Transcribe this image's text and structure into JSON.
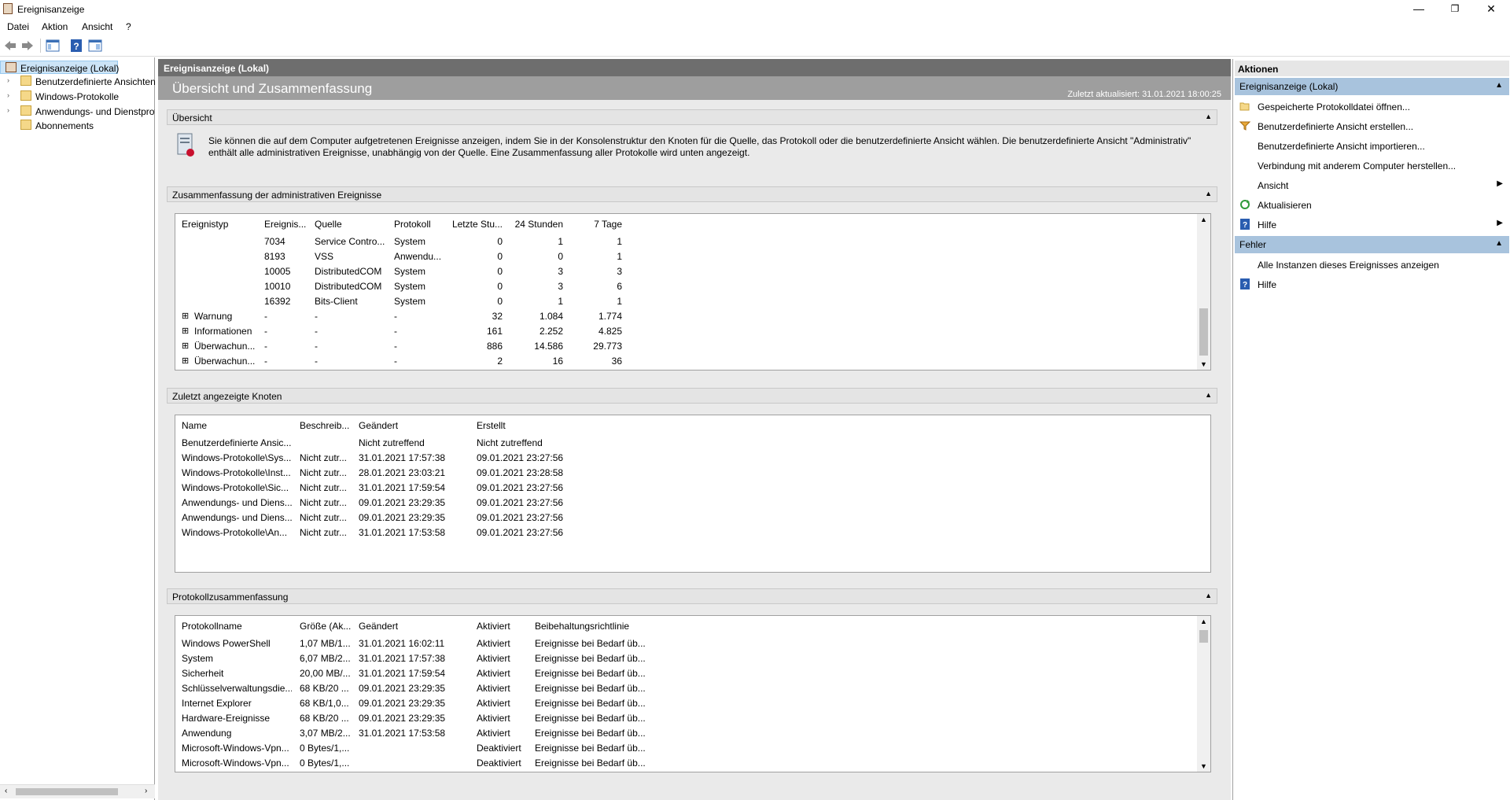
{
  "window": {
    "title": "Ereignisanzeige",
    "minimize": "—",
    "maximize": "❐",
    "close": "✕"
  },
  "menu": [
    "Datei",
    "Aktion",
    "Ansicht",
    "?"
  ],
  "tree": {
    "items": [
      {
        "label": "Ereignisanzeige (Lokal)",
        "level": 0,
        "selected": true
      },
      {
        "label": "Benutzerdefinierte Ansichten",
        "level": 1
      },
      {
        "label": "Windows-Protokolle",
        "level": 1
      },
      {
        "label": "Anwendungs- und Dienstprotokolle",
        "level": 1
      },
      {
        "label": "Abonnements",
        "level": 1
      }
    ]
  },
  "center": {
    "header": "Ereignisanzeige (Lokal)",
    "subtitle": "Übersicht und Zusammenfassung",
    "updated": "Zuletzt aktualisiert: 31.01.2021 18:00:25",
    "overview": {
      "title": "Übersicht",
      "text": "Sie können die auf dem Computer aufgetretenen Ereignisse anzeigen, indem Sie in der Konsolenstruktur den Knoten für die Quelle, das Protokoll oder die benutzerdefinierte Ansicht wählen. Die benutzerdefinierte Ansicht \"Administrativ\" enthält alle administrativen Ereignisse, unabhängig von der Quelle. Eine Zusammenfassung aller Protokolle wird unten angezeigt."
    },
    "summary": {
      "title": "Zusammenfassung der administrativen Ereignisse",
      "columns": [
        "Ereignistyp",
        "Ereignis...",
        "Quelle",
        "Protokoll",
        "Letzte Stu...",
        "24 Stunden",
        "7 Tage"
      ],
      "rows": [
        [
          "",
          "7034",
          "Service Contro...",
          "System",
          "0",
          "1",
          "1"
        ],
        [
          "",
          "8193",
          "VSS",
          "Anwendu...",
          "0",
          "0",
          "1"
        ],
        [
          "",
          "10005",
          "DistributedCOM",
          "System",
          "0",
          "3",
          "3"
        ],
        [
          "",
          "10010",
          "DistributedCOM",
          "System",
          "0",
          "3",
          "6"
        ],
        [
          "",
          "16392",
          "Bits-Client",
          "System",
          "0",
          "1",
          "1"
        ],
        [
          "Warnung",
          "-",
          "-",
          "-",
          "32",
          "1.084",
          "1.774"
        ],
        [
          "Informationen",
          "-",
          "-",
          "-",
          "161",
          "2.252",
          "4.825"
        ],
        [
          "Überwachun...",
          "-",
          "-",
          "-",
          "886",
          "14.586",
          "29.773"
        ],
        [
          "Überwachun...",
          "-",
          "-",
          "-",
          "2",
          "16",
          "36"
        ]
      ]
    },
    "recent": {
      "title": "Zuletzt angezeigte Knoten",
      "columns": [
        "Name",
        "Beschreib...",
        "Geändert",
        "Erstellt"
      ],
      "rows": [
        [
          "Benutzerdefinierte Ansic...",
          "",
          "Nicht zutreffend",
          "Nicht zutreffend"
        ],
        [
          "Windows-Protokolle\\Sys...",
          "Nicht zutr...",
          "31.01.2021 17:57:38",
          "09.01.2021 23:27:56"
        ],
        [
          "Windows-Protokolle\\Inst...",
          "Nicht zutr...",
          "28.01.2021 23:03:21",
          "09.01.2021 23:28:58"
        ],
        [
          "Windows-Protokolle\\Sic...",
          "Nicht zutr...",
          "31.01.2021 17:59:54",
          "09.01.2021 23:27:56"
        ],
        [
          "Anwendungs- und Diens...",
          "Nicht zutr...",
          "09.01.2021 23:29:35",
          "09.01.2021 23:27:56"
        ],
        [
          "Anwendungs- und Diens...",
          "Nicht zutr...",
          "09.01.2021 23:29:35",
          "09.01.2021 23:27:56"
        ],
        [
          "Windows-Protokolle\\An...",
          "Nicht zutr...",
          "31.01.2021 17:53:58",
          "09.01.2021 23:27:56"
        ]
      ]
    },
    "logs": {
      "title": "Protokollzusammenfassung",
      "columns": [
        "Protokollname",
        "Größe (Ak...",
        "Geändert",
        "Aktiviert",
        "Beibehaltungsrichtlinie"
      ],
      "rows": [
        [
          "Windows PowerShell",
          "1,07 MB/1...",
          "31.01.2021 16:02:11",
          "Aktiviert",
          "Ereignisse bei Bedarf üb..."
        ],
        [
          "System",
          "6,07 MB/2...",
          "31.01.2021 17:57:38",
          "Aktiviert",
          "Ereignisse bei Bedarf üb..."
        ],
        [
          "Sicherheit",
          "20,00 MB/...",
          "31.01.2021 17:59:54",
          "Aktiviert",
          "Ereignisse bei Bedarf üb..."
        ],
        [
          "Schlüsselverwaltungsdie...",
          "68 KB/20 ...",
          "09.01.2021 23:29:35",
          "Aktiviert",
          "Ereignisse bei Bedarf üb..."
        ],
        [
          "Internet Explorer",
          "68 KB/1,0...",
          "09.01.2021 23:29:35",
          "Aktiviert",
          "Ereignisse bei Bedarf üb..."
        ],
        [
          "Hardware-Ereignisse",
          "68 KB/20 ...",
          "09.01.2021 23:29:35",
          "Aktiviert",
          "Ereignisse bei Bedarf üb..."
        ],
        [
          "Anwendung",
          "3,07 MB/2...",
          "31.01.2021 17:53:58",
          "Aktiviert",
          "Ereignisse bei Bedarf üb..."
        ],
        [
          "Microsoft-Windows-Vpn...",
          "0 Bytes/1,...",
          "",
          "Deaktiviert",
          "Ereignisse bei Bedarf üb..."
        ],
        [
          "Microsoft-Windows-Vpn...",
          "0 Bytes/1,...",
          "",
          "Deaktiviert",
          "Ereignisse bei Bedarf üb..."
        ]
      ]
    }
  },
  "actions": {
    "title": "Aktionen",
    "group1": {
      "title": "Ereignisanzeige (Lokal)",
      "items": [
        {
          "label": "Gespeicherte Protokolldatei öffnen...",
          "icon": "folder-open-icon"
        },
        {
          "label": "Benutzerdefinierte Ansicht erstellen...",
          "icon": "filter-icon"
        },
        {
          "label": "Benutzerdefinierte Ansicht importieren...",
          "icon": ""
        },
        {
          "label": "Verbindung mit anderem Computer herstellen...",
          "icon": ""
        },
        {
          "label": "Ansicht",
          "icon": "",
          "submenu": true
        },
        {
          "label": "Aktualisieren",
          "icon": "refresh-icon"
        },
        {
          "label": "Hilfe",
          "icon": "help-icon",
          "submenu": true
        }
      ]
    },
    "group2": {
      "title": "Fehler",
      "items": [
        {
          "label": "Alle Instanzen dieses Ereignisses anzeigen",
          "icon": ""
        },
        {
          "label": "Hilfe",
          "icon": "help-icon"
        }
      ]
    }
  }
}
